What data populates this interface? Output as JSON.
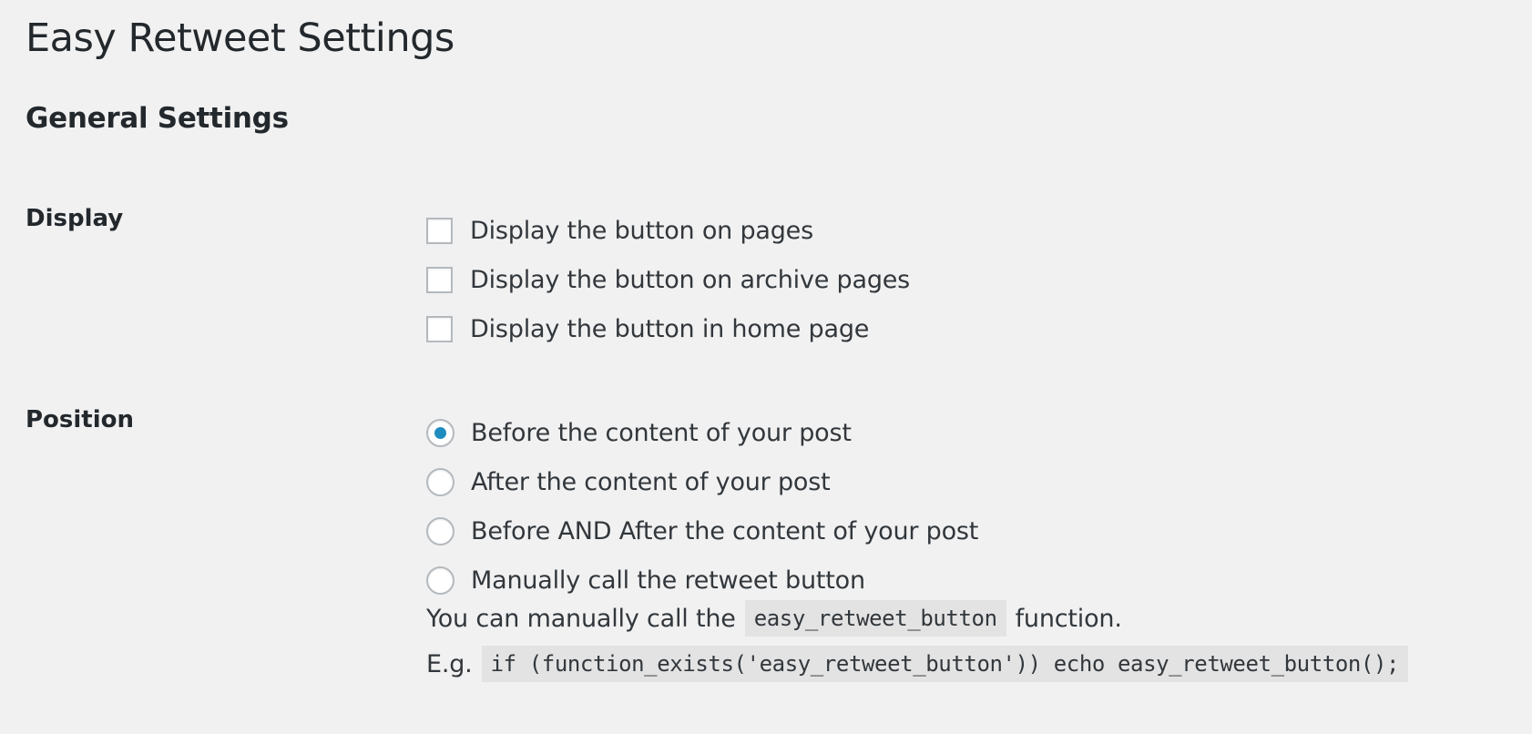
{
  "page": {
    "title": "Easy Retweet Settings",
    "section_title": "General Settings"
  },
  "display": {
    "label": "Display",
    "options": [
      {
        "label": "Display the button on pages",
        "checked": false
      },
      {
        "label": "Display the button on archive pages",
        "checked": false
      },
      {
        "label": "Display the button in home page",
        "checked": false
      }
    ]
  },
  "position": {
    "label": "Position",
    "options": [
      {
        "label": "Before the content of your post",
        "selected": true
      },
      {
        "label": "After the content of your post",
        "selected": false
      },
      {
        "label": "Before AND After the content of your post",
        "selected": false
      },
      {
        "label": "Manually call the retweet button",
        "selected": false
      }
    ],
    "help_prefix": "You can manually call the",
    "help_code": "easy_retweet_button",
    "help_suffix": "function.",
    "example_prefix": "E.g.",
    "example_code": "if (function_exists('easy_retweet_button')) echo easy_retweet_button();"
  },
  "colors": {
    "background": "#f1f1f1",
    "text": "#23282d",
    "radio_accent": "#1e8cbe",
    "code_background": "#e3e3e3"
  }
}
